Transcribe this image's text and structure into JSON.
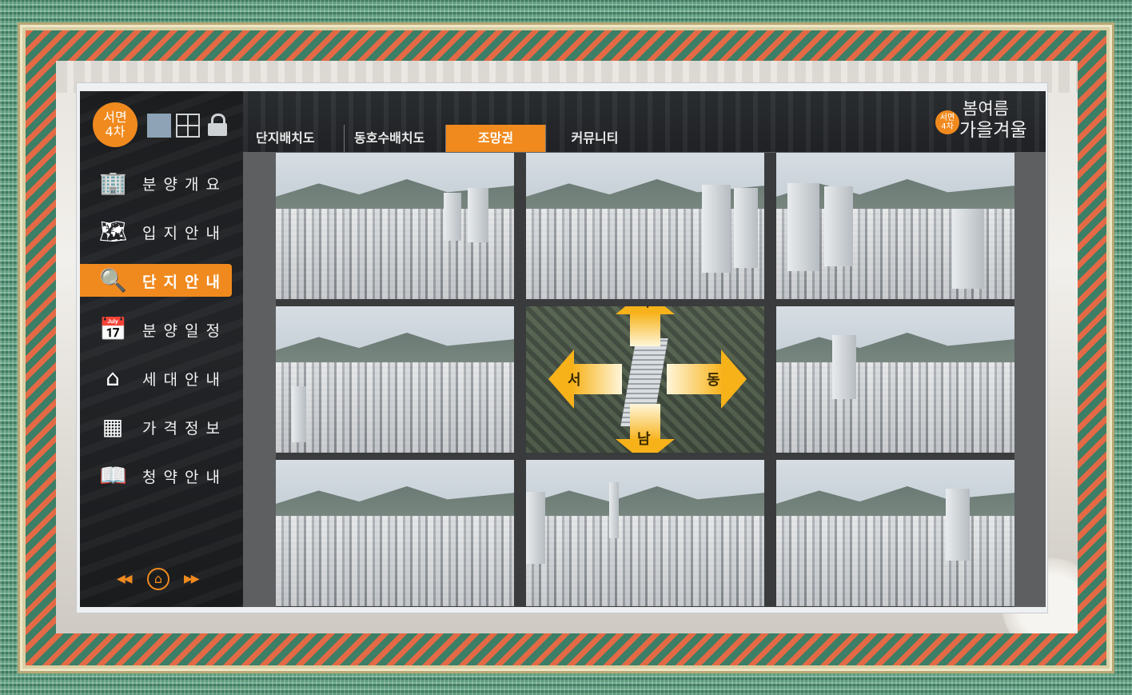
{
  "brand": {
    "line1": "서면",
    "line2": "4차"
  },
  "logo": {
    "badge1": "서면",
    "badge2": "4차",
    "title1": "봄여름",
    "title2": "가을겨울"
  },
  "sidebar": {
    "items": [
      {
        "label": "분양개요",
        "icon": "building-icon",
        "active": false
      },
      {
        "label": "입지안내",
        "icon": "map-pin-icon",
        "active": false
      },
      {
        "label": "단지안내",
        "icon": "search-home-icon",
        "active": true
      },
      {
        "label": "분양일정",
        "icon": "calendar-icon",
        "active": false
      },
      {
        "label": "세대안내",
        "icon": "house-icon",
        "active": false
      },
      {
        "label": "가격정보",
        "icon": "calculator-icon",
        "active": false
      },
      {
        "label": "청약안내",
        "icon": "book-icon",
        "active": false
      }
    ]
  },
  "tabs": [
    {
      "label": "단지배치도",
      "active": false
    },
    {
      "label": "동호수배치도",
      "active": false
    },
    {
      "label": "조망권",
      "active": true
    },
    {
      "label": "커뮤니티",
      "active": false
    }
  ],
  "compass": {
    "north": "북",
    "south": "남",
    "west": "서",
    "east": "동"
  },
  "views": [
    "northwest-view",
    "north-view",
    "northeast-view",
    "west-view",
    "compass",
    "east-view",
    "southwest-view",
    "south-view",
    "southeast-view"
  ],
  "colors": {
    "accent": "#f08a1e",
    "arrow": "#f7b21a",
    "sidebar_bg": "#1d1f22"
  }
}
